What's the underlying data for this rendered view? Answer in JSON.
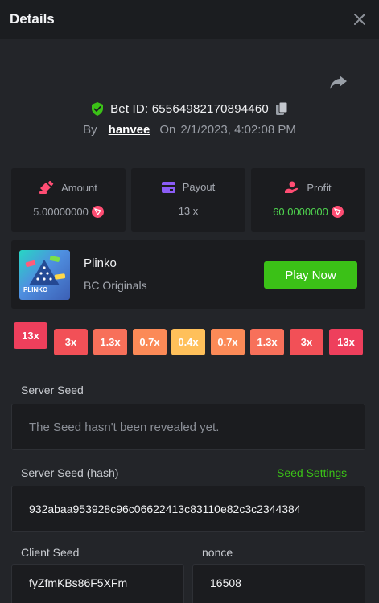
{
  "header": {
    "title": "Details"
  },
  "bet": {
    "id_label": "Bet ID: 65564982170894460",
    "by_label": "By",
    "user": "hanvee",
    "on_label": "On",
    "datetime": "2/1/2023, 4:02:08 PM"
  },
  "stats": {
    "amount": {
      "label": "Amount",
      "value_dim": "5.",
      "value_main": "00000000"
    },
    "payout": {
      "label": "Payout",
      "value": "13 x"
    },
    "profit": {
      "label": "Profit",
      "value_green": "60.",
      "value_main": "0000000"
    }
  },
  "game": {
    "thumb_text": "PLINKO",
    "name": "Plinko",
    "provider": "BC Originals",
    "play_label": "Play Now"
  },
  "multipliers": [
    "13x",
    "3x",
    "1.3x",
    "0.7x",
    "0.4x",
    "0.7x",
    "1.3x",
    "3x",
    "13x"
  ],
  "server_seed": {
    "label": "Server Seed",
    "value": "The Seed hasn't been revealed yet."
  },
  "server_seed_hash": {
    "label": "Server Seed (hash)",
    "settings_label": "Seed Settings",
    "value": "932abaa953928c96c06622413c83110e82c3c2344384"
  },
  "client_seed": {
    "label": "Client Seed",
    "value": "fyZfmKBs86F5XFm"
  },
  "nonce": {
    "label": "nonce",
    "value": "16508"
  },
  "colors": {
    "background": "#232529",
    "card": "#1b1c1f",
    "accent_green": "#3bc117",
    "coin": "#ff4d73",
    "mult_red": "#ee3f5c",
    "mult_coral": "#f7645a",
    "mult_orange": "#fb8a57",
    "mult_peach": "#fda25a",
    "mult_yellow": "#ffc05a"
  }
}
